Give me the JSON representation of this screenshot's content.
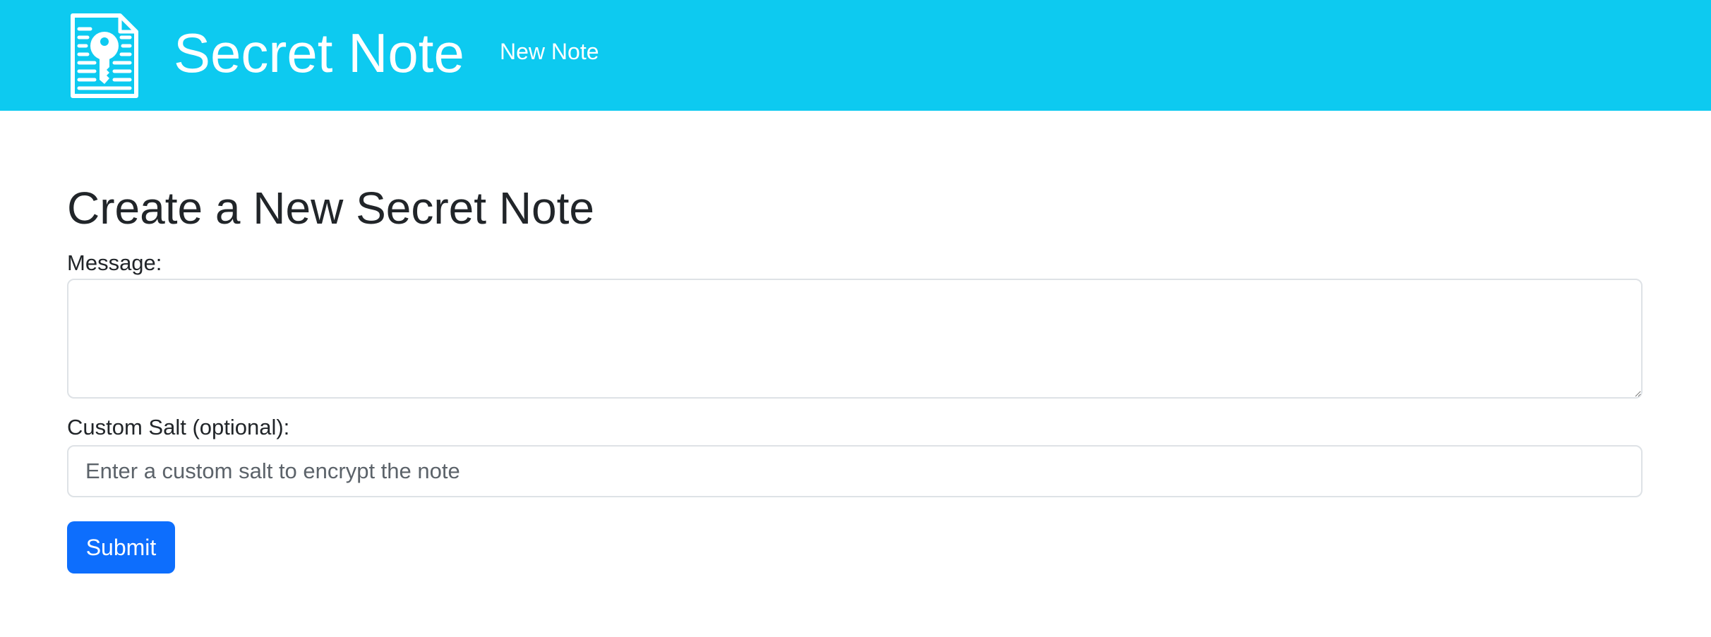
{
  "navbar": {
    "brand_title": "Secret Note",
    "logo_icon": "document-key-icon",
    "nav_link": "New Note",
    "background_color": "#0dcaf0"
  },
  "form": {
    "title": "Create a New Secret Note",
    "message_label": "Message:",
    "message_value": "",
    "salt_label": "Custom Salt (optional):",
    "salt_placeholder": "Enter a custom salt to encrypt the note",
    "salt_value": "",
    "submit_label": "Submit",
    "submit_color": "#0d6efd"
  }
}
